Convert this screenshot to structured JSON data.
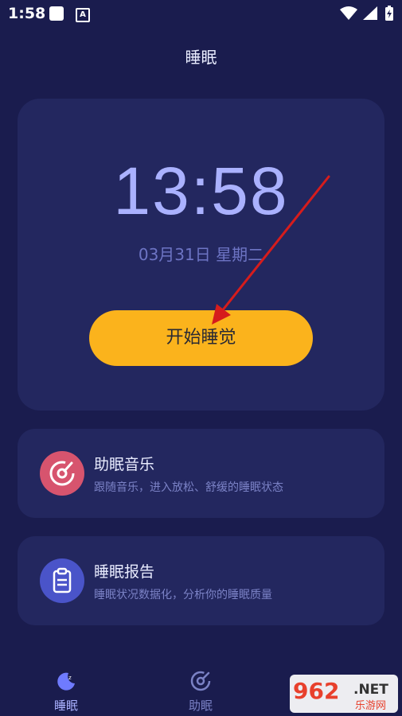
{
  "status_bar": {
    "time": "1:58",
    "a_badge": "A"
  },
  "header": {
    "title": "睡眠"
  },
  "clock_card": {
    "time": "13:58",
    "date": "03月31日 星期二",
    "start_button": "开始睡觉"
  },
  "features": [
    {
      "title": "助眠音乐",
      "desc": "跟随音乐，进入放松、舒缓的睡眠状态",
      "icon": "music-disc-icon",
      "color": "#d7546e"
    },
    {
      "title": "睡眠报告",
      "desc": "睡眠状况数据化，分析你的睡眠质量",
      "icon": "clipboard-icon",
      "color": "#4a54c9"
    }
  ],
  "bottom_nav": [
    {
      "label": "睡眠",
      "icon": "moon-icon",
      "active": true
    },
    {
      "label": "助眠",
      "icon": "music-disc-icon",
      "active": false
    }
  ],
  "watermark": {
    "number": "962",
    "suffix": ".NET",
    "cn": "乐游网"
  },
  "colors": {
    "bg": "#1a1c4e",
    "card": "#23275f",
    "accent": "#fbb31c",
    "clock": "#aab1ff"
  }
}
